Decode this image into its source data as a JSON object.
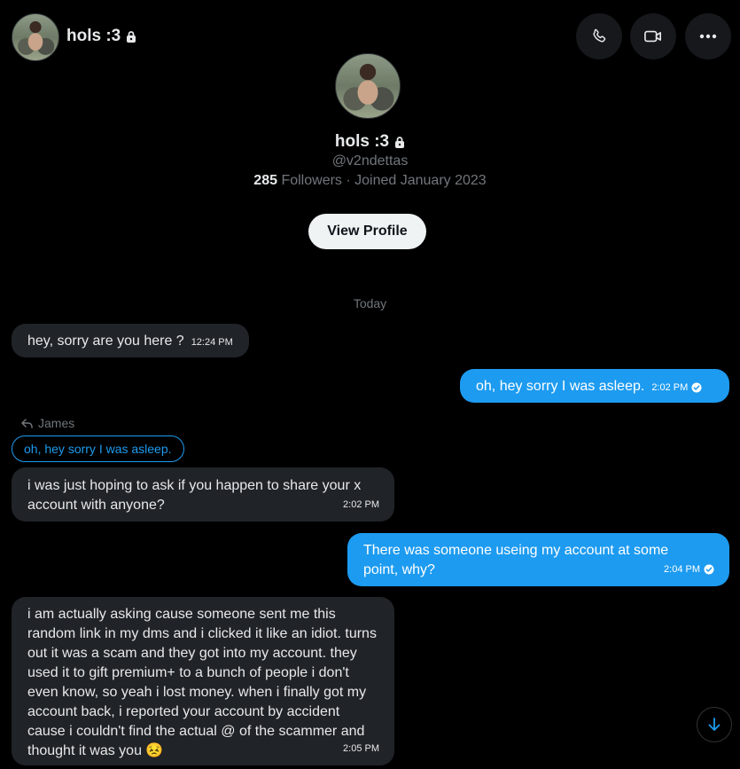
{
  "header": {
    "name": "hols :3"
  },
  "profile": {
    "name": "hols :3",
    "handle": "@v2ndettas",
    "followers_count": "285",
    "followers_text": "Followers · Joined January 2023",
    "view_profile_label": "View Profile"
  },
  "date_separator": "Today",
  "messages": [
    {
      "side": "in",
      "text": "hey, sorry are you here ?",
      "time": "12:24 PM"
    },
    {
      "side": "out",
      "text": "oh, hey sorry I was asleep.",
      "time": "2:02 PM"
    },
    {
      "side": "in",
      "reply_to_name": "James",
      "reply_to_text": "oh, hey sorry I was asleep.",
      "text": "i was just hoping to ask if you happen to share your x account with anyone?",
      "time": "2:02 PM"
    },
    {
      "side": "out",
      "text": "There was someone useing my account at some point, why?",
      "time": "2:04 PM"
    },
    {
      "side": "in",
      "text": "i am actually asking cause someone sent me this random link in my dms and i clicked it like an idiot. turns out it was a scam and they got into my account. they used it to gift premium+ to a bunch of people i don't even know, so yeah i lost money. when i finally got my account back, i reported your account by accident cause i couldn't find the actual @ of the scammer and thought it was you",
      "emoji": "😣",
      "time": "2:05 PM"
    }
  ],
  "colors": {
    "accent": "#1d9bf0",
    "incoming_bubble": "#202327",
    "background": "#000000"
  },
  "icons": [
    "lock-icon",
    "phone-icon",
    "video-icon",
    "more-icon",
    "reply-icon",
    "read-check-icon",
    "scroll-down-icon"
  ]
}
